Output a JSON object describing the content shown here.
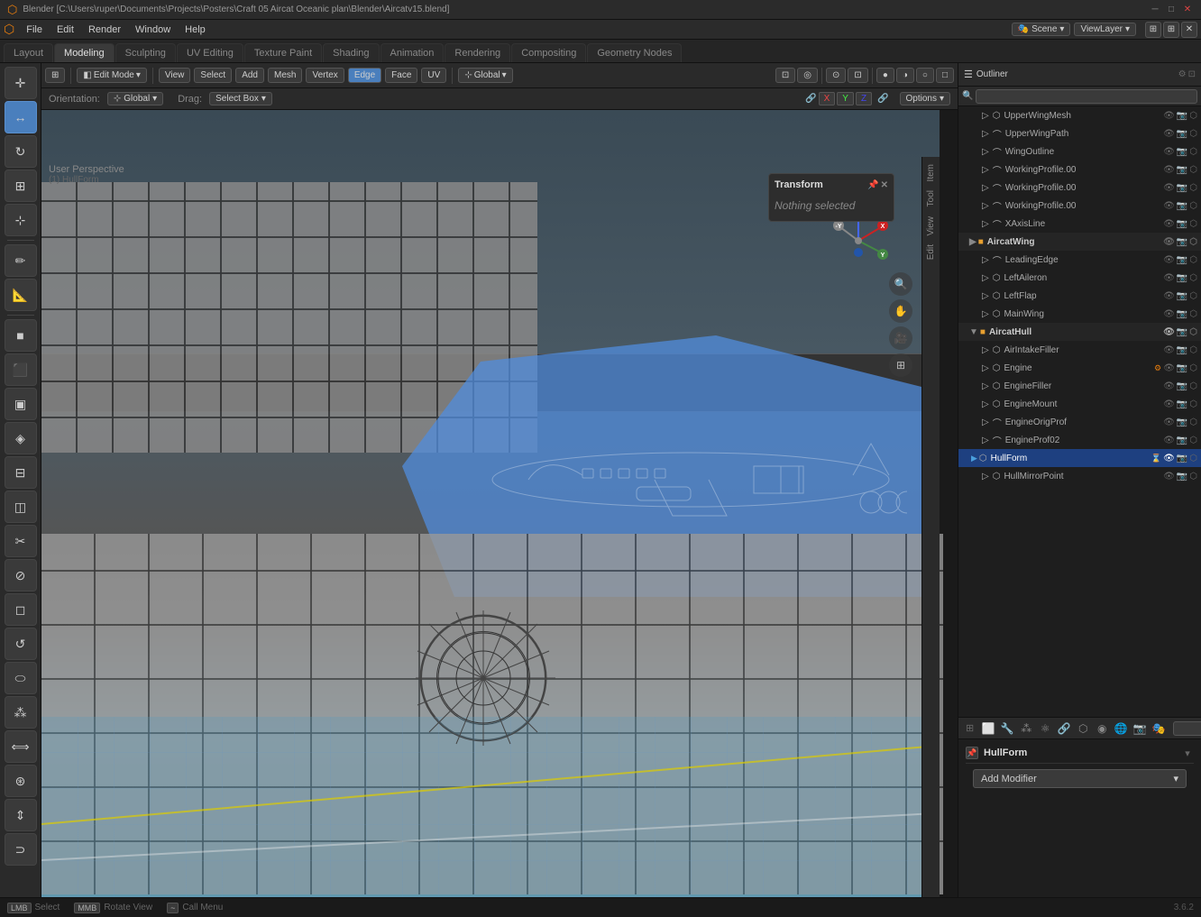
{
  "titlebar": {
    "title": "Blender [C:\\Users\\ruper\\Documents\\Projects\\Posters\\Craft 05 Aircat Oceanic plan\\Blender\\Aircatv15.blend]",
    "controls": [
      "minimize",
      "maximize",
      "close"
    ]
  },
  "menubar": {
    "items": [
      "Blender",
      "File",
      "Edit",
      "Render",
      "Window",
      "Help"
    ]
  },
  "workspacetabs": {
    "tabs": [
      "Layout",
      "Modeling",
      "Sculpting",
      "UV Editing",
      "Texture Paint",
      "Shading",
      "Animation",
      "Rendering",
      "Compositing",
      "Geometry Nodes"
    ]
  },
  "active_tab": "Modeling",
  "viewport_header": {
    "mode": "Edit Mode",
    "view_label": "View",
    "select_label": "Select",
    "add_label": "Add",
    "mesh_label": "Mesh",
    "vertex_label": "Vertex",
    "edge_label": "Edge",
    "face_label": "Face",
    "uv_label": "UV",
    "transform_label": "Global",
    "options_label": "Options"
  },
  "viewport": {
    "label": "User Perspective",
    "sublabel": "(1) HullForm",
    "orientation": "Global",
    "drag": "Select Box"
  },
  "transform_panel": {
    "title": "Transform",
    "message": "Nothing selected"
  },
  "nav_gizmo": {
    "x_label": "X",
    "y_label": "Y",
    "z_label": "Z"
  },
  "nav_icons": [
    "🔍",
    "✋",
    "🎥",
    "⊞"
  ],
  "right_tabs": [
    "Item",
    "Tool",
    "View",
    "Edit"
  ],
  "outliner": {
    "title": "Outliner",
    "search_placeholder": "",
    "items": [
      {
        "name": "UpperWingMesh",
        "depth": 2,
        "type": "mesh",
        "visible": true
      },
      {
        "name": "UpperWingPath",
        "depth": 2,
        "type": "curve",
        "visible": true
      },
      {
        "name": "WingOutline",
        "depth": 2,
        "type": "curve",
        "visible": true
      },
      {
        "name": "WorkingProfile.00",
        "depth": 2,
        "type": "curve",
        "visible": true
      },
      {
        "name": "WorkingProfile.00",
        "depth": 2,
        "type": "curve",
        "visible": true
      },
      {
        "name": "WorkingProfile.00",
        "depth": 2,
        "type": "curve",
        "visible": true
      },
      {
        "name": "XAxisLine",
        "depth": 2,
        "type": "curve",
        "visible": true
      },
      {
        "name": "AircatWing",
        "depth": 1,
        "type": "collection",
        "visible": true
      },
      {
        "name": "LeadingEdge",
        "depth": 2,
        "type": "curve",
        "visible": true
      },
      {
        "name": "LeftAileron",
        "depth": 2,
        "type": "mesh",
        "visible": true
      },
      {
        "name": "LeftFlap",
        "depth": 2,
        "type": "mesh",
        "visible": true
      },
      {
        "name": "MainWing",
        "depth": 2,
        "type": "mesh",
        "visible": true
      },
      {
        "name": "AircatHull",
        "depth": 1,
        "type": "collection",
        "visible": true,
        "bold": true
      },
      {
        "name": "AirIntakeFiller",
        "depth": 2,
        "type": "mesh",
        "visible": true
      },
      {
        "name": "Engine",
        "depth": 2,
        "type": "mesh",
        "visible": true,
        "special": true
      },
      {
        "name": "EngineFiller",
        "depth": 2,
        "type": "mesh",
        "visible": true
      },
      {
        "name": "EngineMount",
        "depth": 2,
        "type": "mesh",
        "visible": true
      },
      {
        "name": "EngineOrigProf",
        "depth": 2,
        "type": "curve",
        "visible": true
      },
      {
        "name": "EngineProf02",
        "depth": 2,
        "type": "curve",
        "visible": true
      },
      {
        "name": "HullForm",
        "depth": 2,
        "type": "mesh",
        "visible": true,
        "selected": true
      },
      {
        "name": "HullMirrorPoint",
        "depth": 2,
        "type": "mesh",
        "visible": true
      }
    ]
  },
  "properties": {
    "title": "HullForm",
    "add_modifier_label": "Add Modifier",
    "search_placeholder": ""
  },
  "prop_icons": [
    "object",
    "mesh",
    "material",
    "particle",
    "physics",
    "constraints",
    "modifier",
    "data"
  ],
  "statusbar": {
    "items": [
      {
        "key": "LMB",
        "label": "Select"
      },
      {
        "key": "MMB",
        "label": "Rotate View"
      },
      {
        "key": "~",
        "label": "Call Menu"
      }
    ],
    "version": "3.6.2"
  },
  "scene_name": "Scene",
  "view_layer": "ViewLayer",
  "icons": {
    "blender": "⬡",
    "expand": "▶",
    "collapse": "▼",
    "visible": "👁",
    "camera": "📷",
    "pin": "📌",
    "close": "✕",
    "minimize": "─",
    "maximize": "□",
    "chevron_down": "▾",
    "search": "🔍",
    "wrench": "🔧"
  }
}
